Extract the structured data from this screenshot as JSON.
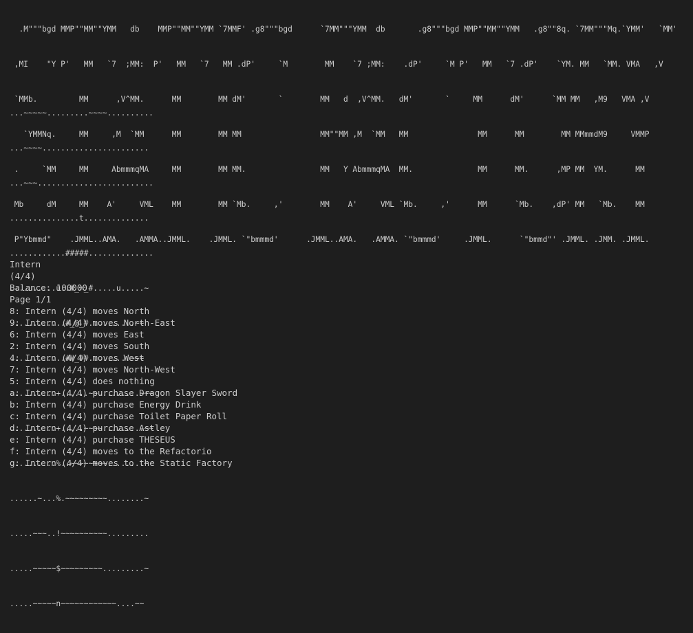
{
  "banner": {
    "lines": [
      "  .M\"\"\"bgd MMP\"\"MM\"\"YMM   db    MMP\"\"MM\"\"YMM `7MMF' .g8\"\"\"bgd      `7MM\"\"\"YMM  db       .g8\"\"\"bgd MMP\"\"MM\"\"YMM   .g8\"\"8q. `7MM\"\"\"Mq.`YMM'   `MM'",
      " ,MI    \"Y P'   MM   `7  ;MM:  P'   MM   `7   MM .dP'     `M        MM    `7 ;MM:    .dP'     `M P'   MM   `7 .dP'    `YM. MM   `MM. VMA   ,V",
      " `MMb.         MM      ,V^MM.      MM        MM dM'       `        MM   d  ,V^MM.   dM'       `     MM      dM'      `MM MM   ,M9   VMA ,V",
      "   `YMMNq.     MM     ,M  `MM      MM        MM MM                 MM\"\"MM ,M  `MM   MM               MM      MM        MM MMmmdM9     VMMP",
      " .     `MM     MM     AbmmmqMA     MM        MM MM.                MM   Y AbmmmqMA  MM.              MM      MM.      ,MP MM  YM.      MM",
      " Mb     dM     MM    A'     VML    MM        MM `Mb.     ,'        MM    A'     VML `Mb.     ,'      MM      `Mb.    ,dP' MM   `Mb.    MM",
      " P\"Ybmmd\"    .JMML..AMA.   .AMMA..JMML.    .JMML. `\"bmmmd'      .JMML..AMA.   .AMMA. `\"bmmmd'     .JMML.      `\"bmmd\"' .JMML. .JMM. .JMML."
    ]
  },
  "map": {
    "rows": [
      "...~~~~~.........~~~~..........",
      "...~~~~.......................",
      "...~~~.........................",
      "...............t..............",
      "............#####..............",
      "....u.....u..#_=_#.....u.....~",
      "............#_@_#..........~~",
      "............##_##.........~~~",
      "..........+......~~.........~~~",
      "..........+.....~~~~.........~~",
      "..........%..~~~~~~~~........~",
      "......~...%.~~~~~~~~~........~",
      ".....~~~..!~~~~~~~~~~.........",
      ".....~~~~~$~~~~~~~~~.........~",
      ".....~~~~~n~~~~~~~~~~~~....~~"
    ]
  },
  "status": {
    "unit_name": "Intern",
    "unit_hp": "(4/4)",
    "balance": "Balance: 100000",
    "page": "Page 1/1"
  },
  "options": [
    {
      "text": "8: Intern (4/4) moves North"
    },
    {
      "text": "9: Intern (4/4) moves North-East"
    },
    {
      "text": "6: Intern (4/4) moves East"
    },
    {
      "text": "2: Intern (4/4) moves South"
    },
    {
      "text": "4: Intern (4/4) moves West"
    },
    {
      "text": "7: Intern (4/4) moves North-West"
    },
    {
      "text": "5: Intern (4/4) does nothing"
    },
    {
      "text": "a: Intern (4/4) purchase Dragon Slayer Sword"
    },
    {
      "text": "b: Intern (4/4) purchase Energy Drink"
    },
    {
      "text": "c: Intern (4/4) purchase Toilet Paper Roll"
    },
    {
      "text": "d: Intern (4/4) purchase Astley"
    },
    {
      "text": "e: Intern (4/4) purchase THESEUS"
    },
    {
      "text": "f: Intern (4/4) moves to the Refactorio"
    },
    {
      "text": "g: Intern (4/4) moves to the Static Factory"
    }
  ]
}
